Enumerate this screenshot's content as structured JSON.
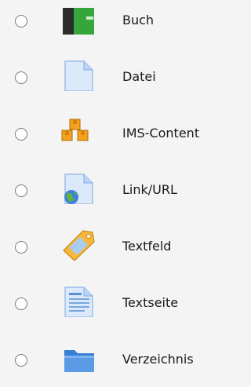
{
  "modules": [
    {
      "label": "Buch",
      "icon": "book-icon",
      "selected": false
    },
    {
      "label": "Datei",
      "icon": "file-icon",
      "selected": false
    },
    {
      "label": "IMS-Content",
      "icon": "ims-content-icon",
      "selected": false
    },
    {
      "label": "Link/URL",
      "icon": "url-icon",
      "selected": false
    },
    {
      "label": "Textfeld",
      "icon": "label-tag-icon",
      "selected": false
    },
    {
      "label": "Textseite",
      "icon": "page-icon",
      "selected": false
    },
    {
      "label": "Verzeichnis",
      "icon": "folder-icon",
      "selected": false
    }
  ]
}
